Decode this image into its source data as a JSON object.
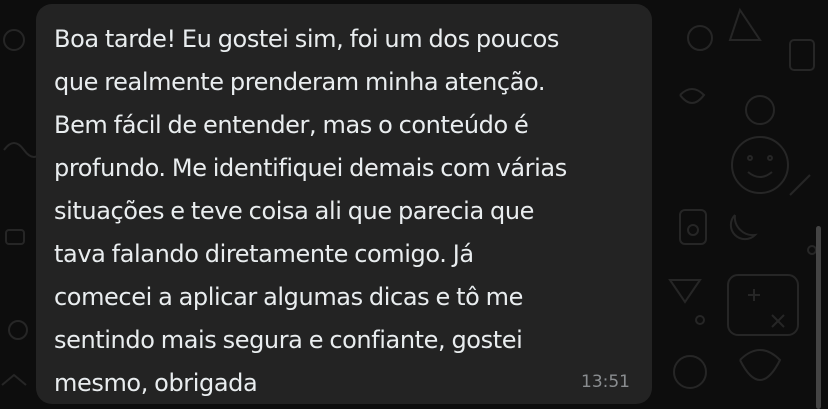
{
  "message": {
    "lines": [
      "Boa tarde! Eu gostei sim, foi um dos poucos",
      "que realmente prenderam minha atenção.",
      "Bem fácil de entender, mas o conteúdo é",
      "profundo. Me identifiquei demais com várias",
      "situações e teve coisa ali que parecia que",
      "tava falando diretamente comigo. Já",
      "comecei a aplicar algumas dicas e tô me",
      "sentindo mais segura e confiante, gostei",
      "mesmo, obrigada"
    ],
    "time": "13:51"
  },
  "colors": {
    "background": "#0d0d0d",
    "bubble": "#232323",
    "text": "#e9edef",
    "timestamp": "#8a8d90"
  }
}
